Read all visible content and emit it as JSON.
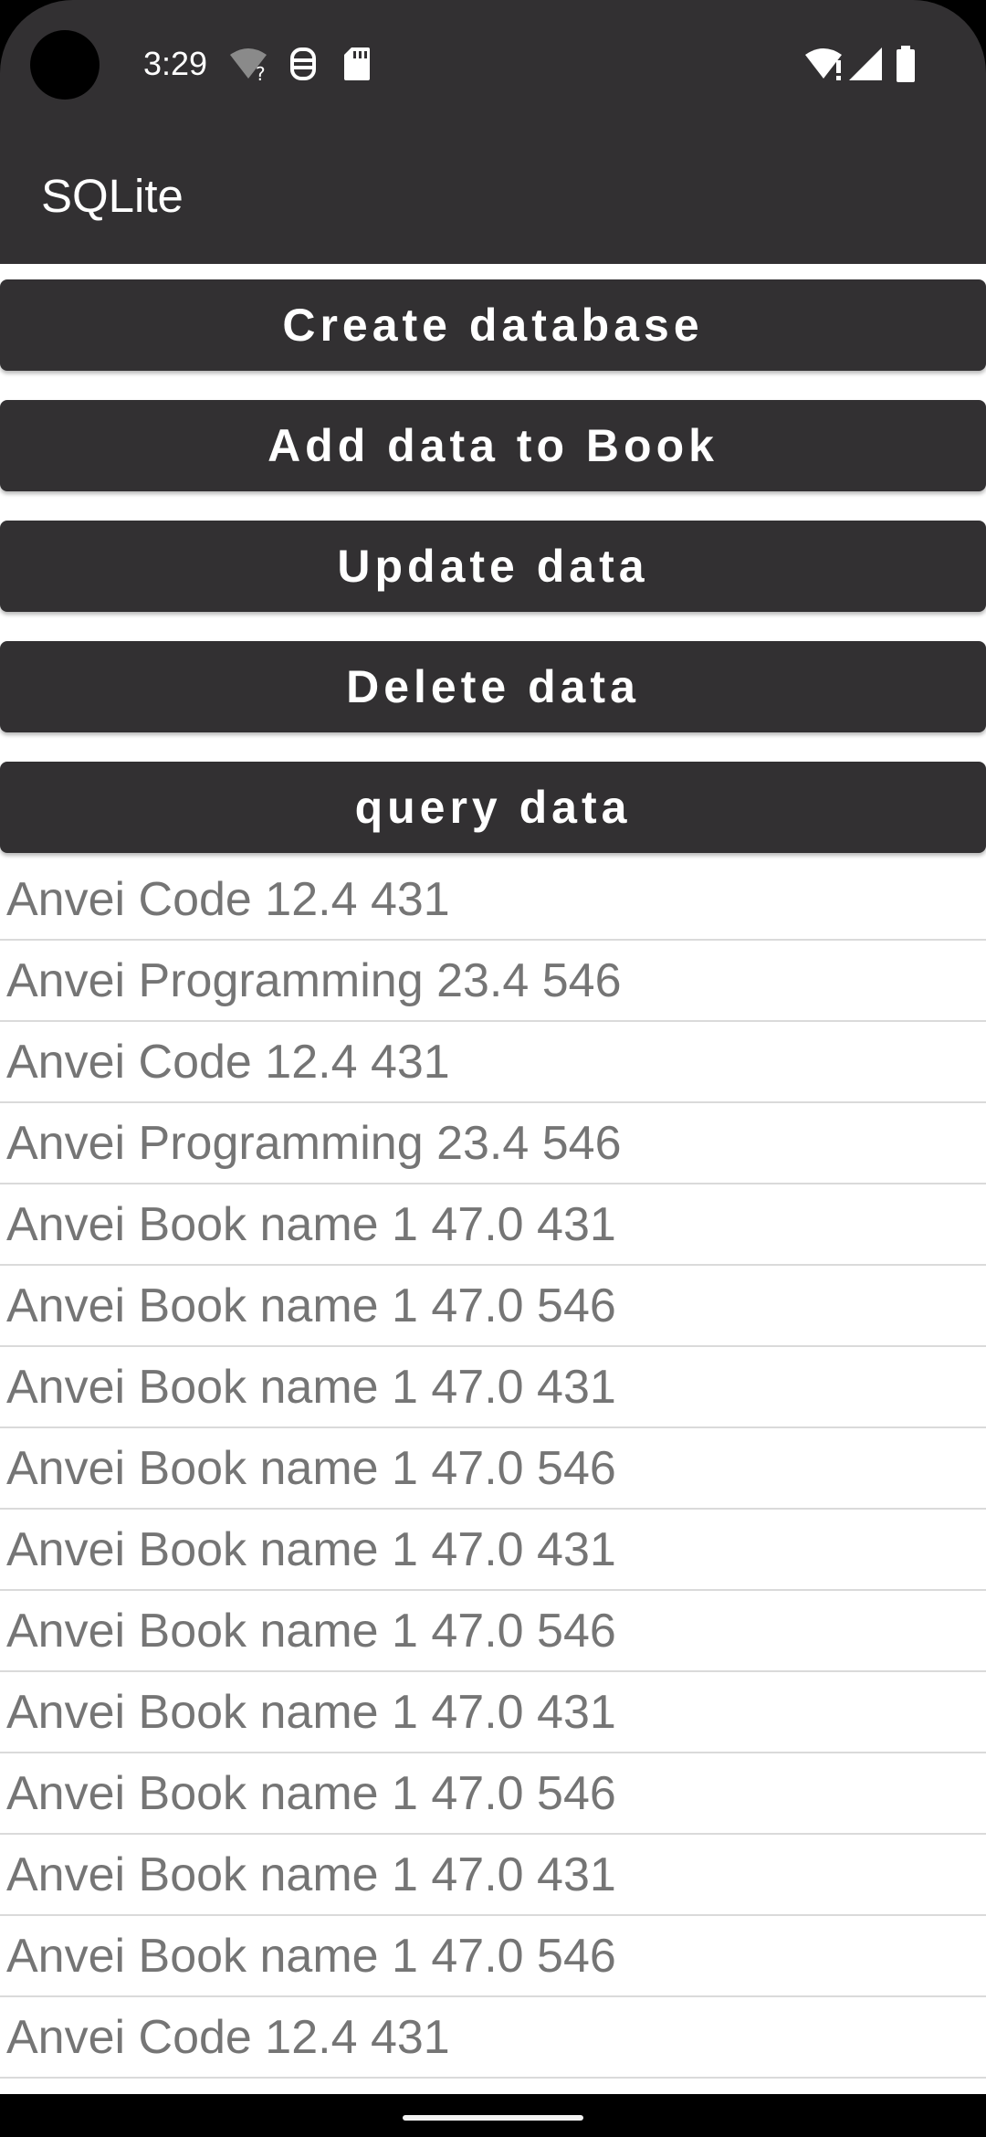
{
  "status_bar": {
    "time": "3:29",
    "icons_left": [
      "wifi-question-icon",
      "wifi-settings-icon",
      "sd-card-icon"
    ],
    "icons_right": [
      "wifi-alert-icon",
      "cell-signal-icon",
      "battery-icon"
    ]
  },
  "app_bar": {
    "title": "SQLite"
  },
  "buttons": [
    {
      "label": "Create database"
    },
    {
      "label": "Add data to Book"
    },
    {
      "label": "Update data"
    },
    {
      "label": "Delete data"
    },
    {
      "label": "query data"
    }
  ],
  "results": [
    "Anvei Code 12.4 431",
    "Anvei Programming 23.4 546",
    "Anvei Code 12.4 431",
    "Anvei Programming 23.4 546",
    "Anvei Book name 1 47.0 431",
    "Anvei Book name 1 47.0 546",
    "Anvei Book name 1 47.0 431",
    "Anvei Book name 1 47.0 546",
    "Anvei Book name 1 47.0 431",
    "Anvei Book name 1 47.0 546",
    "Anvei Book name 1 47.0 431",
    "Anvei Book name 1 47.0 546",
    "Anvei Book name 1 47.0 431",
    "Anvei Book name 1 47.0 546",
    "Anvei Code 12.4 431"
  ],
  "colors": {
    "primary_dark": "#323032",
    "list_text": "#757575",
    "divider": "#dadada"
  }
}
